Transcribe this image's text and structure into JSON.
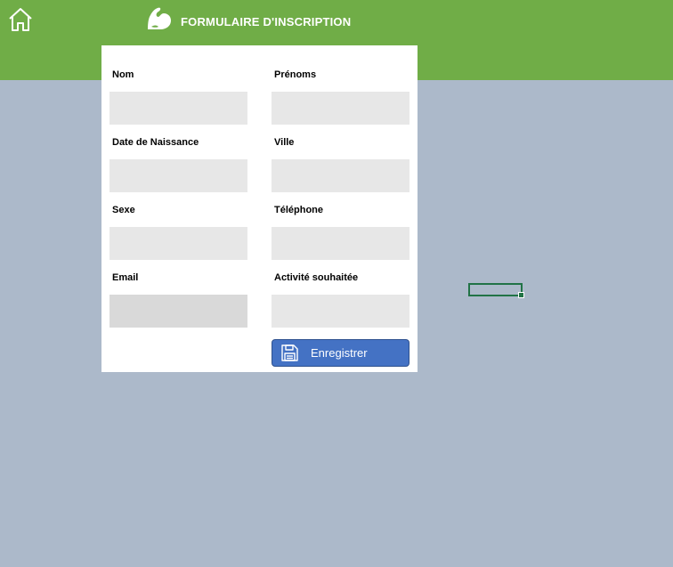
{
  "header": {
    "title": "FORMULAIRE D'INSCRIPTION",
    "home_icon": "home-icon",
    "logo_icon": "flexed-arm-icon"
  },
  "form": {
    "nom": {
      "label": "Nom",
      "value": ""
    },
    "prenoms": {
      "label": "Prénoms",
      "value": ""
    },
    "date_naissance": {
      "label": "Date de Naissance",
      "value": ""
    },
    "ville": {
      "label": "Ville",
      "value": ""
    },
    "sexe": {
      "label": "Sexe",
      "value": ""
    },
    "telephone": {
      "label": "Téléphone",
      "value": ""
    },
    "email": {
      "label": "Email",
      "value": ""
    },
    "activite": {
      "label": "Activité souhaitée",
      "value": ""
    },
    "save_button": {
      "label": "Enregistrer",
      "icon": "floppy-disk-icon"
    }
  },
  "colors": {
    "header_bg": "#70ad47",
    "background": "#acb9ca",
    "field_bg": "#e7e7e7",
    "button_bg": "#4472c4",
    "selection_border": "#217346"
  }
}
